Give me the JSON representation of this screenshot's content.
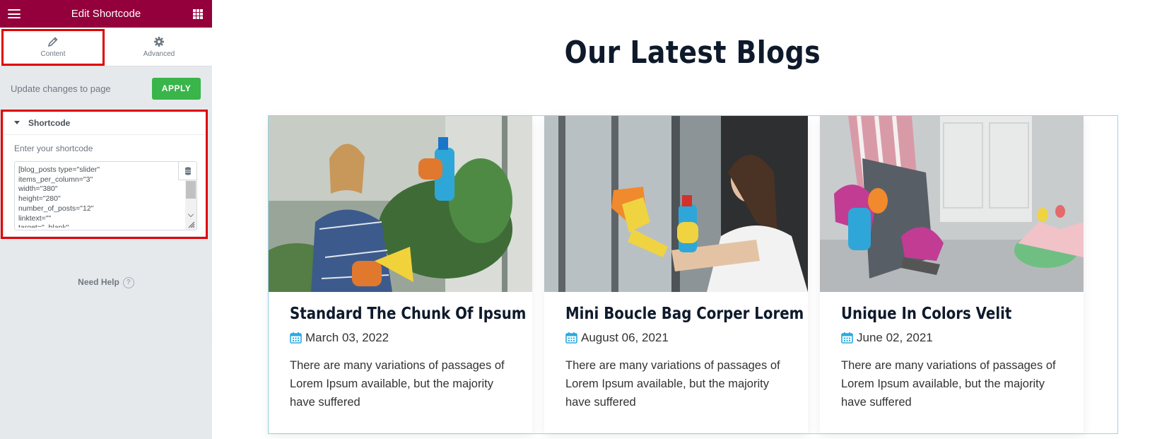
{
  "panel": {
    "title": "Edit Shortcode",
    "tabs": [
      {
        "label": "Content",
        "icon": "pencil-icon"
      },
      {
        "label": "Advanced",
        "icon": "gear-icon"
      }
    ],
    "update_text": "Update changes to page",
    "apply_label": "APPLY",
    "section_title": "Shortcode",
    "field_label": "Enter your shortcode",
    "shortcode_value": "[blog_posts type=\"slider\"\nitems_per_column=\"3\"\nwidth=\"380\"\nheight=\"280\"\nnumber_of_posts=\"12\"\nlinktext=\"\"\ntarget=\"_blank\"",
    "need_help": "Need Help",
    "help_glyph": "?"
  },
  "preview": {
    "heading": "Our Latest Blogs",
    "cards": [
      {
        "title": "Standard The Chunk Of Ipsum",
        "date": "March 03, 2022",
        "excerpt": "There are many variations of passages of Lorem Ipsum available, but the majority have suffered"
      },
      {
        "title": "Mini Boucle Bag Corper Lorem",
        "date": "August 06, 2021",
        "excerpt": "There are many variations of passages of Lorem Ipsum available, but the majority have suffered"
      },
      {
        "title": "Unique In Colors Velit",
        "date": "June 02, 2021",
        "excerpt": "There are many variations of passages of Lorem Ipsum available, but the majority have suffered"
      }
    ]
  },
  "colors": {
    "panel_header": "#93003c",
    "apply_green": "#39b54a",
    "highlight_red": "#e00000",
    "calendar_blue": "#29a8e0",
    "heading_navy": "#0e1a2b"
  }
}
